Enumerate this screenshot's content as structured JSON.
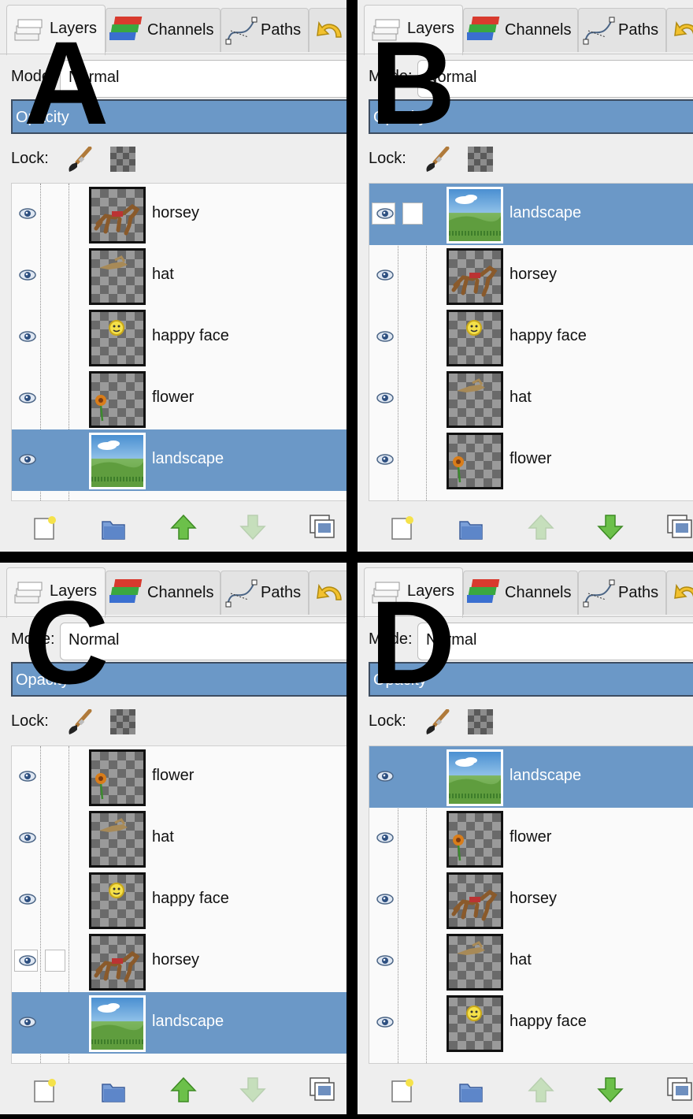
{
  "tabs": {
    "layers": "Layers",
    "channels": "Channels",
    "paths": "Paths"
  },
  "mode": {
    "label": "Mode:",
    "value": "Normal"
  },
  "opacity": {
    "label": "Opacity"
  },
  "lock": {
    "label": "Lock:"
  },
  "colors": {
    "selection": "#6b98c7",
    "panel": "#eeeeee",
    "divider": "#000000"
  },
  "icons": {
    "tabs": [
      "layers-icon",
      "channels-icon",
      "paths-icon",
      "undo-icon"
    ],
    "toolbar": [
      "new-layer-icon",
      "new-group-icon",
      "raise-layer-icon",
      "lower-layer-icon",
      "duplicate-layer-icon"
    ]
  },
  "panels": [
    {
      "letter": "A",
      "selected": 4,
      "layers": [
        {
          "name": "horsey"
        },
        {
          "name": "hat"
        },
        {
          "name": "happy face"
        },
        {
          "name": "flower"
        },
        {
          "name": "landscape"
        }
      ]
    },
    {
      "letter": "B",
      "selected": 0,
      "layers": [
        {
          "name": "landscape"
        },
        {
          "name": "horsey"
        },
        {
          "name": "happy face"
        },
        {
          "name": "hat"
        },
        {
          "name": "flower"
        }
      ]
    },
    {
      "letter": "C",
      "selected": 4,
      "layers": [
        {
          "name": "flower"
        },
        {
          "name": "hat"
        },
        {
          "name": "happy face"
        },
        {
          "name": "horsey"
        },
        {
          "name": "landscape"
        }
      ]
    },
    {
      "letter": "D",
      "selected": 0,
      "layers": [
        {
          "name": "landscape"
        },
        {
          "name": "flower"
        },
        {
          "name": "horsey"
        },
        {
          "name": "hat"
        },
        {
          "name": "happy face"
        }
      ]
    }
  ]
}
